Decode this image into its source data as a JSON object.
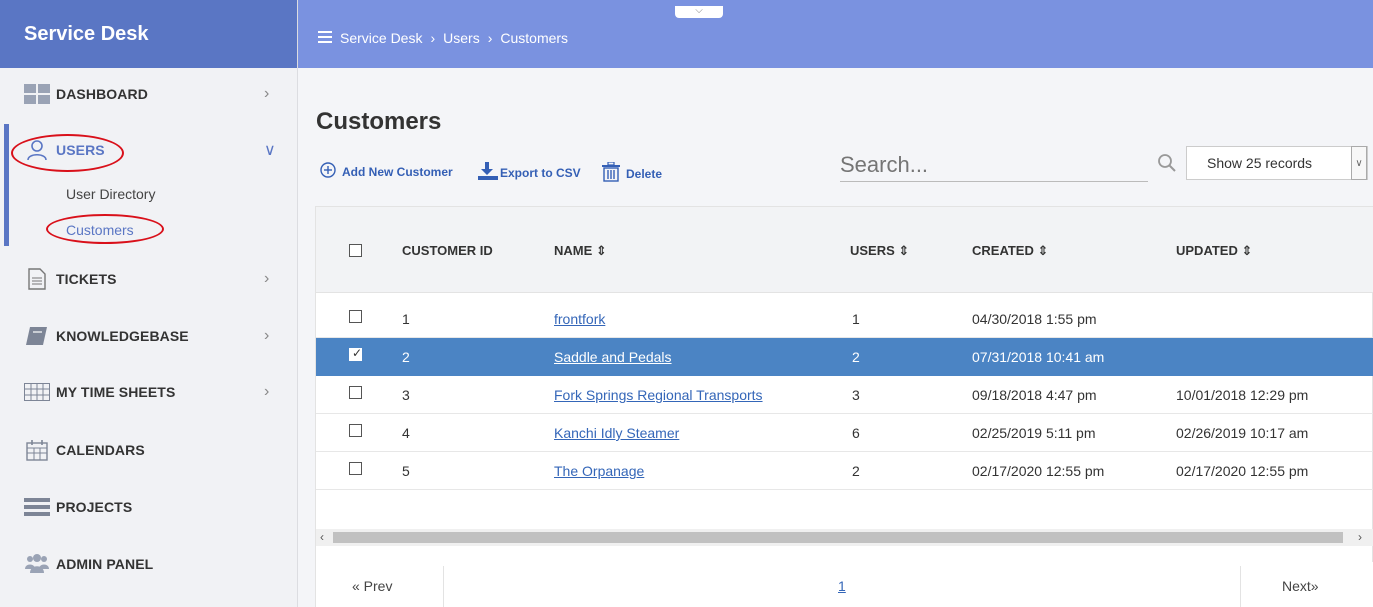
{
  "app": {
    "title": "Service Desk"
  },
  "sidebar": {
    "items": [
      {
        "label": "DASHBOARD",
        "icon": "dashboard-icon",
        "has_chevron": true
      },
      {
        "label": "USERS",
        "icon": "user-icon",
        "has_chevron": true,
        "expanded": true,
        "sub_items": [
          {
            "label": "User Directory"
          },
          {
            "label": "Customers",
            "active": true
          }
        ]
      },
      {
        "label": "TICKETS",
        "icon": "document-icon",
        "has_chevron": true
      },
      {
        "label": "KNOWLEDGEBASE",
        "icon": "book-icon",
        "has_chevron": true
      },
      {
        "label": "MY TIME SHEETS",
        "icon": "timesheet-grid-icon",
        "has_chevron": true
      },
      {
        "label": "CALENDARS",
        "icon": "calendar-icon",
        "has_chevron": false
      },
      {
        "label": "PROJECTS",
        "icon": "projects-icon",
        "has_chevron": false
      },
      {
        "label": "ADMIN PANEL",
        "icon": "admin-group-icon",
        "has_chevron": false
      }
    ]
  },
  "topbar": {
    "breadcrumb": [
      "Service Desk",
      "Users",
      "Customers"
    ]
  },
  "main": {
    "title": "Customers",
    "toolbar": {
      "add_label": "Add New Customer",
      "export_label": "Export to CSV",
      "delete_label": "Delete"
    },
    "search": {
      "placeholder": "Search..."
    },
    "records_select": {
      "selected": "Show 25 records"
    }
  },
  "table": {
    "columns": [
      "CUSTOMER ID",
      "NAME ⇕",
      "USERS ⇕",
      "CREATED ⇕",
      "UPDATED ⇕"
    ],
    "rows": [
      {
        "id": "1",
        "name": "frontfork",
        "users": "1",
        "created": "04/30/2018 1:55 pm",
        "updated": "",
        "selected": false
      },
      {
        "id": "2",
        "name": "Saddle and Pedals",
        "users": "2",
        "created": "07/31/2018 10:41 am",
        "updated": "",
        "selected": true
      },
      {
        "id": "3",
        "name": "Fork Springs Regional Transports",
        "users": "3",
        "created": "09/18/2018 4:47 pm",
        "updated": "10/01/2018 12:29 pm",
        "selected": false
      },
      {
        "id": "4",
        "name": "Kanchi Idly Steamer",
        "users": "6",
        "created": "02/25/2019 5:11 pm",
        "updated": "02/26/2019 10:17 am",
        "selected": false
      },
      {
        "id": "5",
        "name": "The Orpanage",
        "users": "2",
        "created": "02/17/2020 12:55 pm",
        "updated": "02/17/2020 12:55 pm",
        "selected": false
      }
    ]
  },
  "pagination": {
    "prev_label": "« Prev",
    "next_label": "Next»",
    "current_page": "1"
  },
  "colors": {
    "brand": "#5a76c4",
    "topbar": "#7a92e0",
    "selected_row": "#4b84c4",
    "annotation": "#d9101a"
  }
}
